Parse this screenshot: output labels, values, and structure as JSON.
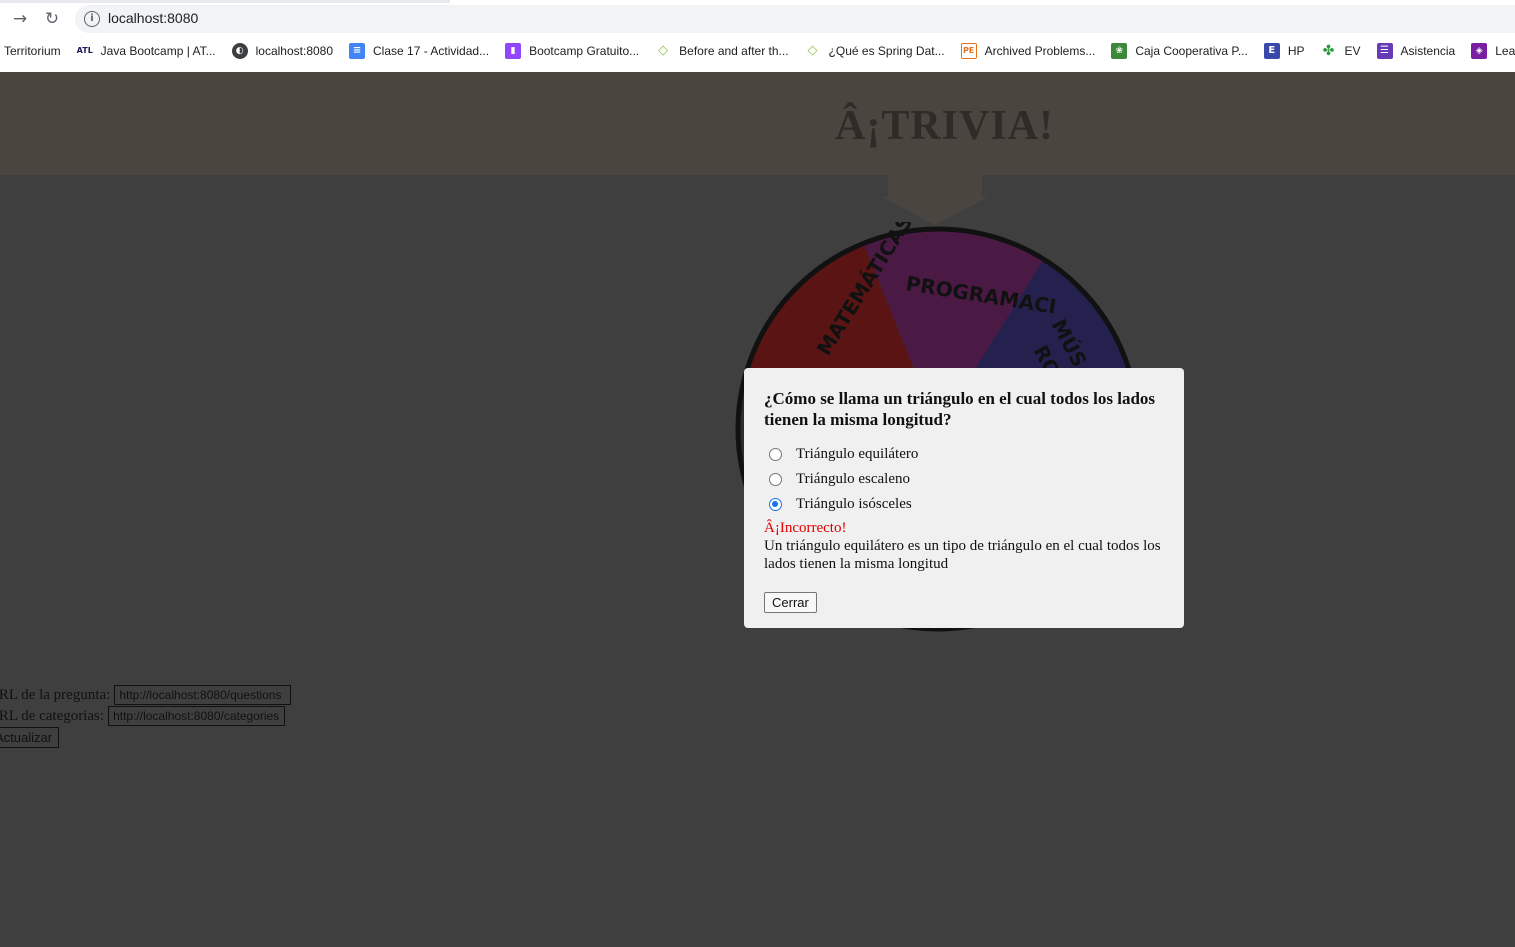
{
  "browser": {
    "url": "localhost:8080",
    "bookmarks": [
      {
        "label": "Territorium",
        "icon": "",
        "color": ""
      },
      {
        "label": "Java Bootcamp | AT...",
        "icon": "ATL",
        "color": "#ffffff"
      },
      {
        "label": "localhost:8080",
        "icon": "globe",
        "color": "#3c4043"
      },
      {
        "label": "Clase 17 - Actividad...",
        "icon": "doc",
        "color": "#4285f4"
      },
      {
        "label": "Bootcamp Gratuito...",
        "icon": "twitch",
        "color": "#9146ff"
      },
      {
        "label": "Before and after th...",
        "icon": "diamond",
        "color": "#8bc34a"
      },
      {
        "label": "¿Qué es Spring Dat...",
        "icon": "diamond",
        "color": "#8bc34a"
      },
      {
        "label": "Archived Problems...",
        "icon": "PE",
        "color": "#e8711c"
      },
      {
        "label": "Caja Cooperativa P...",
        "icon": "coop",
        "color": "#3a8a3a"
      },
      {
        "label": "HP",
        "icon": "E",
        "color": "#3949ab"
      },
      {
        "label": "EV",
        "icon": "clover",
        "color": "#2e9a3e"
      },
      {
        "label": "Asistencia",
        "icon": "list",
        "color": "#673ab7"
      },
      {
        "label": "Learner",
        "icon": "lp",
        "color": "#7b1fa2"
      }
    ]
  },
  "page": {
    "title": "Â¡TRIVIA!"
  },
  "wheel": {
    "segments": [
      {
        "label": "MATEMÁTICAS",
        "color": "#5a1414"
      },
      {
        "label": "PROGRAMACIÓN",
        "color": "#4a1a45"
      },
      {
        "label": "MÚSICA ROCK",
        "color": "#25214f"
      }
    ],
    "visible_labels": [
      "MATEMÁTICAS",
      "PROGRAMACI",
      "MÚS",
      "RO"
    ]
  },
  "modal": {
    "question": "¿Cómo se llama un triángulo en el cual todos los lados tienen la misma longitud?",
    "options": [
      {
        "label": "Triángulo equilátero",
        "checked": false
      },
      {
        "label": "Triángulo escaleno",
        "checked": false
      },
      {
        "label": "Triángulo isósceles",
        "checked": true
      }
    ],
    "result": "Â¡Incorrecto!",
    "explanation": "Un triángulo equilátero es un tipo de triángulo en el cual todos los lados tienen la misma longitud",
    "close_label": "Cerrar"
  },
  "config": {
    "question_url_label": "URL de la pregunta:",
    "question_url_value": "http://localhost:8080/questions",
    "categories_url_label": "URL de categorias:",
    "categories_url_value": "http://localhost:8080/categories",
    "update_label": "Actualizar"
  },
  "colors": {
    "accent": "#1a73e8",
    "error": "#e00000",
    "background": "#3f3f3f"
  }
}
